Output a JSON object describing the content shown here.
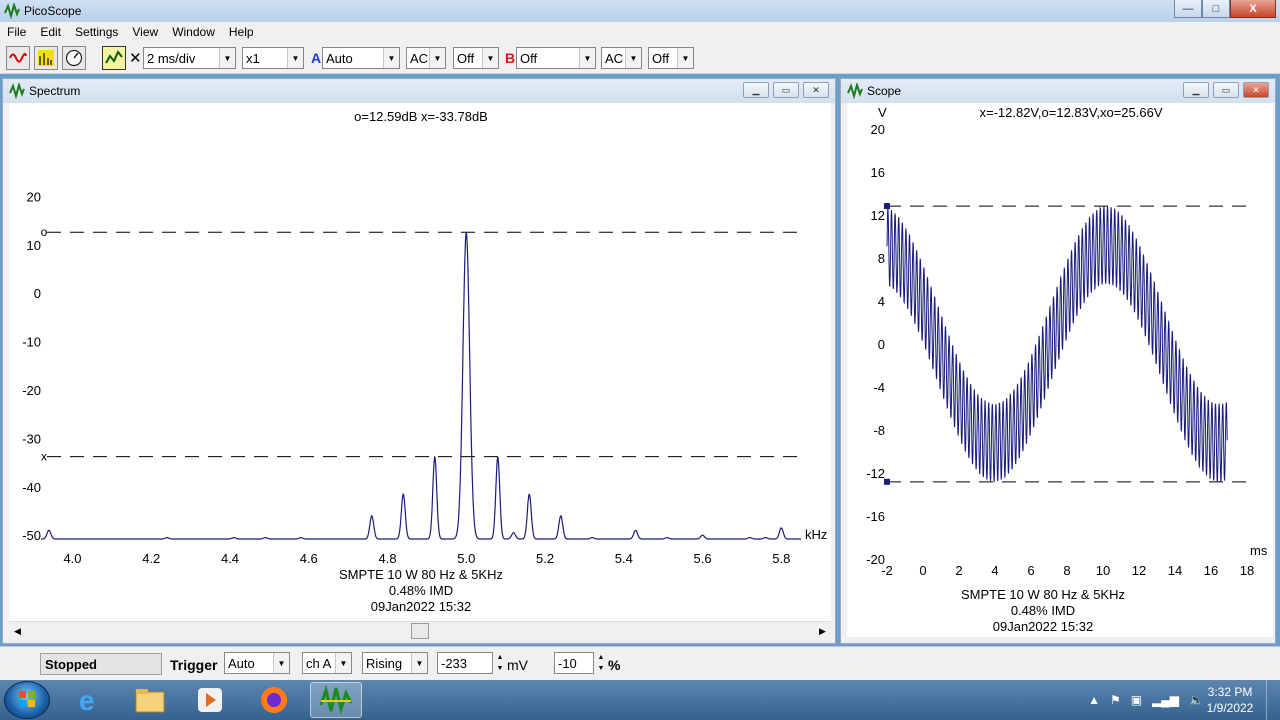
{
  "window": {
    "title": "PicoScope",
    "buttons": {
      "minimize": "—",
      "maximize": "□",
      "close": "X"
    }
  },
  "menu": [
    "File",
    "Edit",
    "Settings",
    "View",
    "Window",
    "Help"
  ],
  "toolbar": {
    "close_glyph": "✕",
    "timebase": "2 ms/div",
    "multiplier": "x1",
    "channel_a_label": "A",
    "channel_a_range": "Auto",
    "channel_a_coupling": "AC",
    "channel_a_offset": "Off",
    "channel_b_label": "B",
    "channel_b_range": "Off",
    "channel_b_coupling": "AC",
    "channel_b_offset": "Off",
    "colors": {
      "channel_a": "#1a3bd6",
      "channel_b": "#d61a1a"
    }
  },
  "spectrum_window": {
    "title": "Spectrum",
    "readout": "o=12.59dB  x=-33.78dB",
    "caption_line1": "SMPTE 10 W 80 Hz & 5KHz",
    "caption_line2": "0.48% IMD",
    "caption_line3": "09Jan2022  15:32"
  },
  "scope_window": {
    "title": "Scope",
    "readout": "x=-12.82V,o=12.83V,xo=25.66V",
    "caption_line1": "SMPTE 10 W 80 Hz & 5KHz",
    "caption_line2": "0.48% IMD",
    "caption_line3": "09Jan2022  15:32"
  },
  "chart_data": [
    {
      "type": "line",
      "title": "Spectrum",
      "xlabel": "kHz",
      "ylabel": "",
      "xlim": [
        3.92,
        5.85
      ],
      "ylim": [
        -51,
        24
      ],
      "x_ticks": [
        "4.0",
        "4.2",
        "4.4",
        "4.6",
        "4.8",
        "5.0",
        "5.2",
        "5.4",
        "5.6",
        "5.8"
      ],
      "y_ticks": [
        "20",
        "10",
        "0",
        "-10",
        "-20",
        "-30",
        "-40",
        "-50"
      ],
      "cursor_o_db": 12.59,
      "cursor_x_db": -33.78,
      "cursor_o_marker": "o",
      "cursor_x_marker": "x",
      "peaks": [
        {
          "x": 3.94,
          "y": -49
        },
        {
          "x": 4.24,
          "y": -50.5
        },
        {
          "x": 4.41,
          "y": -50.5
        },
        {
          "x": 4.49,
          "y": -50.5
        },
        {
          "x": 4.58,
          "y": -50.5
        },
        {
          "x": 4.76,
          "y": -46
        },
        {
          "x": 4.84,
          "y": -41.5
        },
        {
          "x": 4.92,
          "y": -33.8
        },
        {
          "x": 5.0,
          "y": 12.6
        },
        {
          "x": 5.08,
          "y": -33.8
        },
        {
          "x": 5.12,
          "y": -49.5
        },
        {
          "x": 5.16,
          "y": -41.5
        },
        {
          "x": 5.24,
          "y": -46
        },
        {
          "x": 5.32,
          "y": -50.5
        },
        {
          "x": 5.43,
          "y": -49
        },
        {
          "x": 5.51,
          "y": -50.5
        },
        {
          "x": 5.6,
          "y": -50
        },
        {
          "x": 5.72,
          "y": -50.5
        },
        {
          "x": 5.76,
          "y": -50.5
        },
        {
          "x": 5.8,
          "y": -48.5
        }
      ]
    },
    {
      "type": "line",
      "title": "Scope",
      "xlabel": "ms",
      "ylabel": "V",
      "xlim": [
        -2,
        18
      ],
      "ylim": [
        -20,
        20
      ],
      "x_ticks": [
        "-2",
        "0",
        "2",
        "4",
        "6",
        "8",
        "10",
        "12",
        "14",
        "16",
        "18"
      ],
      "y_ticks": [
        "20",
        "16",
        "12",
        "8",
        "4",
        "0",
        "-4",
        "-8",
        "-12",
        "-16",
        "-20"
      ],
      "cursor_o_v": 12.83,
      "cursor_x_v": -12.82,
      "signal": {
        "low_freq_hz": 80,
        "low_amplitude_v": 9.2,
        "low_phase_peak_ms": 10.2,
        "high_freq_khz": 5,
        "high_amplitude_v": 3.6,
        "x_start_ms": -2,
        "x_end_ms": 16.9
      }
    }
  ],
  "status": {
    "state": "Stopped",
    "trigger_label": "Trigger",
    "trigger_mode": "Auto",
    "trigger_channel": "ch A",
    "trigger_edge": "Rising",
    "trigger_level": "-233",
    "trigger_level_unit": "mV",
    "pre_trigger": "-10",
    "pre_trigger_unit": "%"
  },
  "taskbar": {
    "clock_time": "3:32 PM",
    "clock_date": "1/9/2022",
    "apps": [
      "internet-explorer",
      "file-explorer",
      "media-player",
      "firefox",
      "picoscope"
    ]
  }
}
